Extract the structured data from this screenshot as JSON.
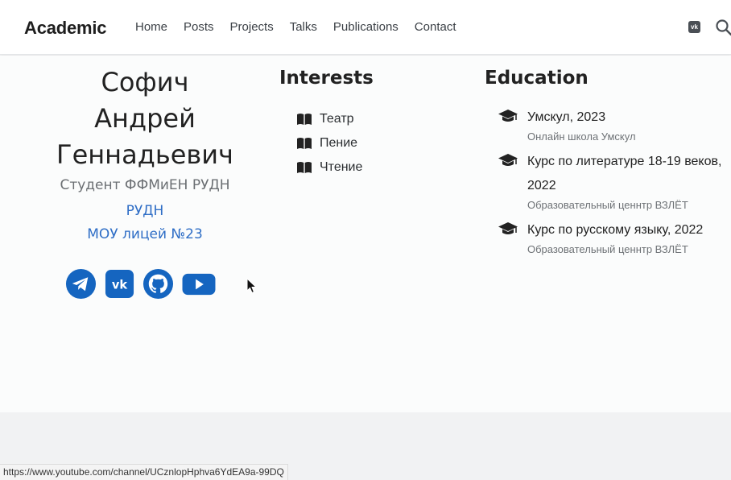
{
  "navbar": {
    "brand": "Academic",
    "links": [
      "Home",
      "Posts",
      "Projects",
      "Talks",
      "Publications",
      "Contact"
    ],
    "vk_icon": "vk-icon",
    "search_icon": "search-icon"
  },
  "profile": {
    "name_lines": [
      "Софич",
      "Андрей",
      "Геннадьевич"
    ],
    "role": "Студент ФФМиЕН РУДН",
    "organizations": [
      "РУДН",
      "МОУ лицей №23"
    ],
    "socials": [
      "telegram-icon",
      "vk-icon",
      "github-icon",
      "youtube-icon"
    ]
  },
  "interests": {
    "title": "Interests",
    "items": [
      "Театр",
      "Пение",
      "Чтение"
    ]
  },
  "education": {
    "title": "Education",
    "items": [
      {
        "course": "Умскул, 2023",
        "institution": "Онлайн школа Умскул"
      },
      {
        "course": "Курс по литературе 18-19 веков, 2022",
        "institution": "Образовательный ценнтр ВЗЛЁТ"
      },
      {
        "course": "Курс по русскому языку, 2022",
        "institution": "Образовательный ценнтр ВЗЛЁТ"
      }
    ]
  },
  "status_bar": {
    "url": "https://www.youtube.com/channel/UCznlopHphva6YdEA9a-99DQ"
  },
  "colors": {
    "link_blue": "#2f6ec6",
    "social_blue": "#1565c0",
    "page_bg": "#fbfcfc",
    "footer_bg": "#f1f2f3"
  }
}
